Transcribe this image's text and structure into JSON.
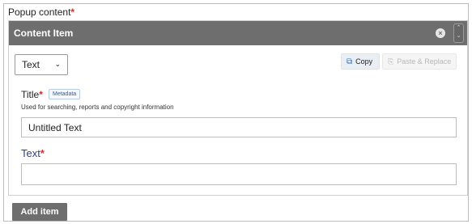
{
  "section": {
    "label": "Popup content",
    "required_mark": "*"
  },
  "panel": {
    "title": "Content Item",
    "close_icon": "×",
    "reorder_up": "⌃",
    "reorder_down": "⌄"
  },
  "type_select": {
    "value": "Text",
    "chevron": "⌄"
  },
  "actions": {
    "copy_label": "Copy",
    "copy_icon": "⧉",
    "paste_label": "Paste & Replace",
    "paste_icon": "⎘"
  },
  "title_field": {
    "label": "Title",
    "required_mark": "*",
    "badge": "Metadata",
    "help": "Used for searching, reports and copyright information",
    "value": "Untitled Text"
  },
  "text_field": {
    "label": "Text",
    "required_mark": "*",
    "value": ""
  },
  "add_button": {
    "label": "Add item"
  },
  "colors": {
    "header_bg": "#6e6e6e",
    "required": "#d0302c",
    "text_label": "#2b3f8a",
    "copy_bg": "#e9eef4"
  }
}
